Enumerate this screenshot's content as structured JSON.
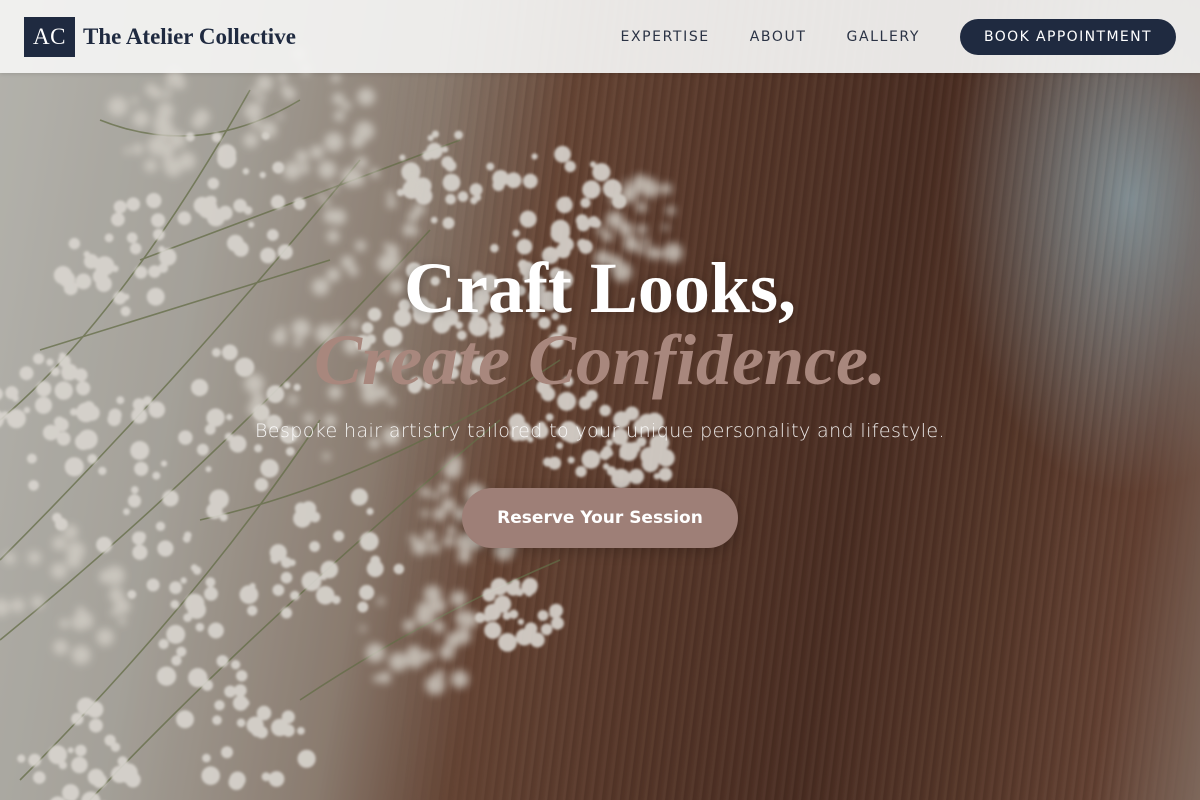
{
  "brand": {
    "logo_initials": "AC",
    "name": "The Atelier Collective",
    "color": "#1f2a40"
  },
  "nav": {
    "links": [
      {
        "label": "EXPERTISE"
      },
      {
        "label": "ABOUT"
      },
      {
        "label": "GALLERY"
      }
    ],
    "cta_label": "BOOK APPOINTMENT"
  },
  "hero": {
    "headline_line1": "Craft Looks,",
    "headline_line2": "Create Confidence.",
    "subheading": "Bespoke hair artistry tailored to your unique personality and lifestyle.",
    "cta_label": "Reserve Your Session",
    "accent_color": "#9e7f77",
    "background": "photo of long straight brown hair with white baby's breath flowers"
  }
}
